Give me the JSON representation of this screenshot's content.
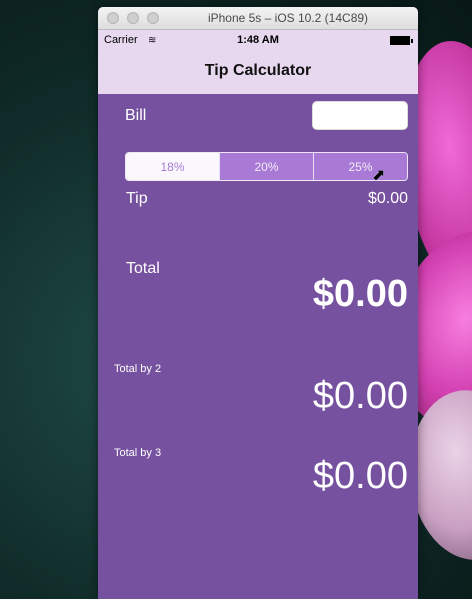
{
  "window": {
    "title": "iPhone 5s – iOS 10.2 (14C89)"
  },
  "status_bar": {
    "carrier": "Carrier",
    "wifi_icon": "wifi-icon",
    "time": "1:48 AM",
    "battery_icon": "battery-icon"
  },
  "nav": {
    "title": "Tip Calculator"
  },
  "bill": {
    "label": "Bill",
    "value": ""
  },
  "tip_selector": {
    "options": [
      "18%",
      "20%",
      "25%"
    ],
    "selected": "18%"
  },
  "tip": {
    "label": "Tip",
    "value": "$0.00"
  },
  "total": {
    "label": "Total",
    "value": "$0.00"
  },
  "total_by_2": {
    "label": "Total by 2",
    "value": "$0.00"
  },
  "total_by_3": {
    "label": "Total by 3",
    "value": "$0.00"
  },
  "colors": {
    "app_background": "#7651a0",
    "nav_background": "#e8d8ef",
    "segment_accent": "#a87ad6"
  }
}
